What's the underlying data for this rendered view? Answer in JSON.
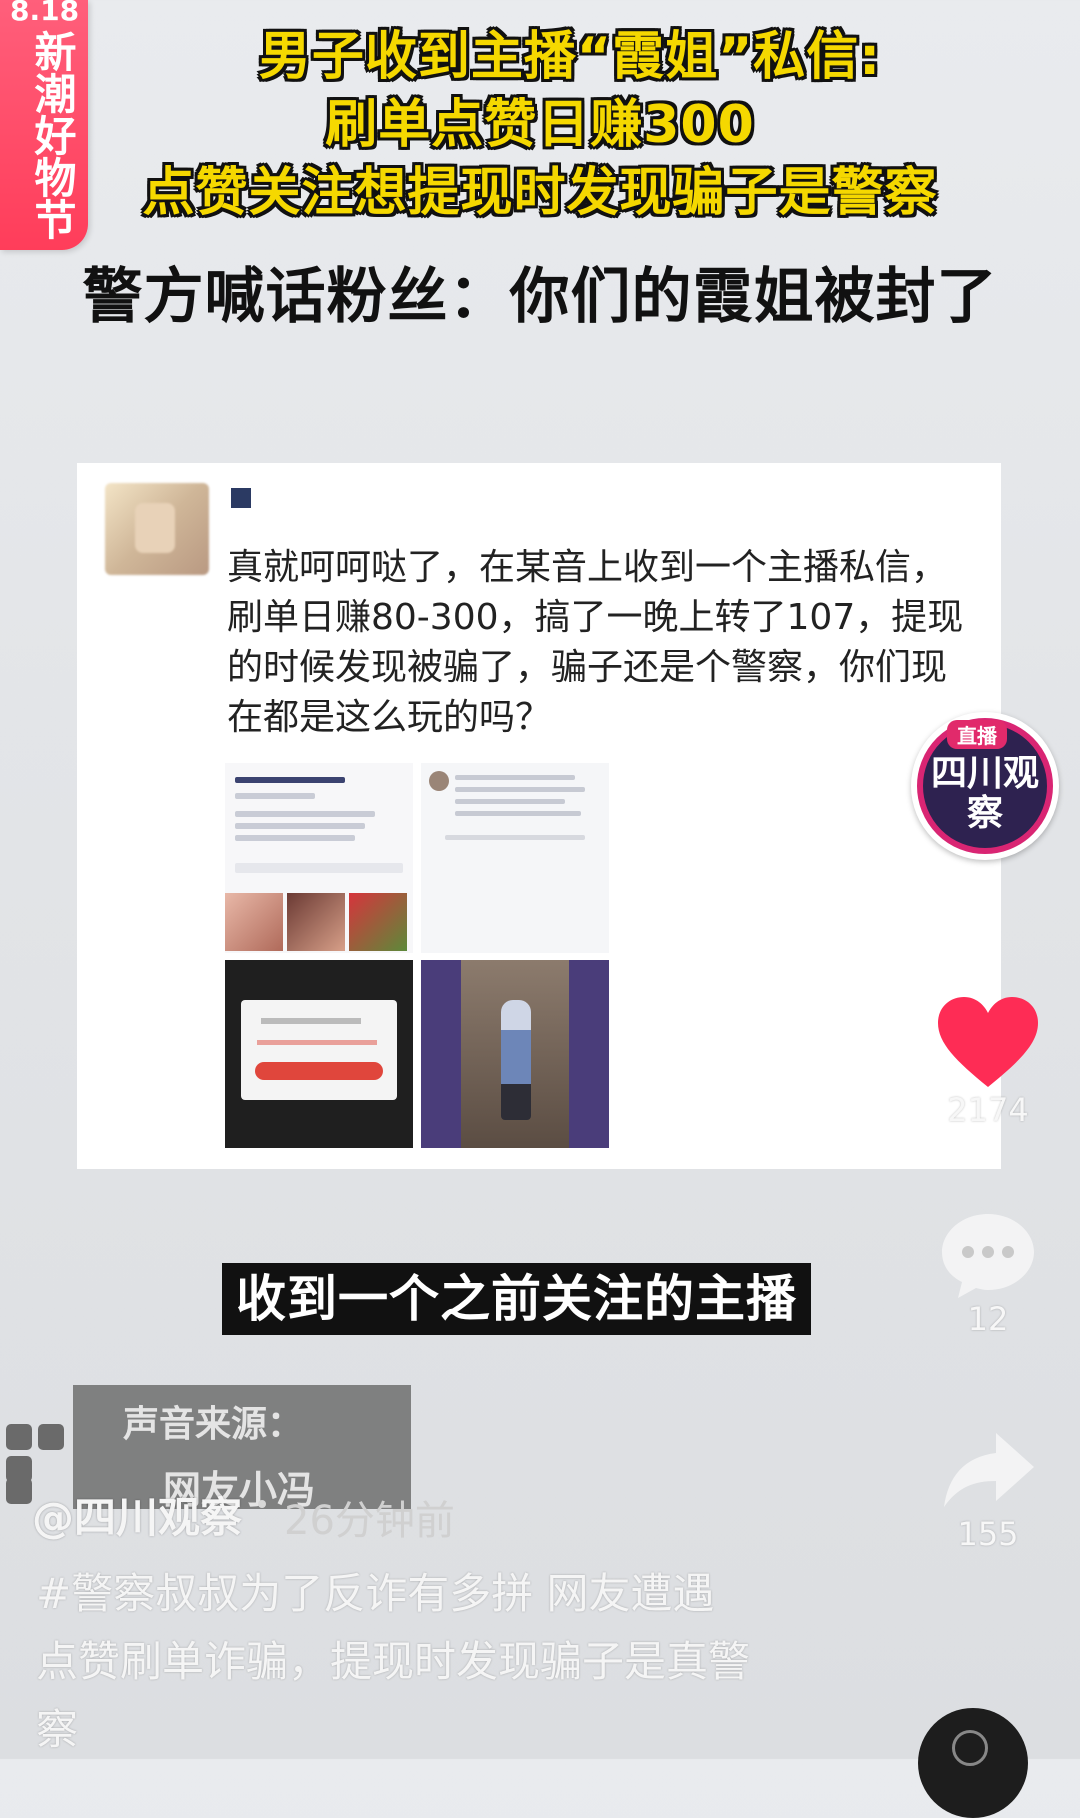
{
  "festival_badge": {
    "top_text": "8.18",
    "label": "新潮好物节"
  },
  "headline": {
    "line1": "男子收到主播“霞姐”私信:",
    "line2": "刷单点赞日赚300",
    "line3": "点赞关注想提现时发现骗子是警察"
  },
  "subheadline": "警方喊话粉丝：你们的霞姐被封了",
  "post": {
    "text": "真就呵呵哒了，在某音上收到一个主播私信，刷单日赚80-300，搞了一晚上转了107，提现的时候发现被骗了，骗子还是个警察，你们现在都是这么玩的吗？"
  },
  "live_badge": {
    "tag": "直播",
    "name": "四川观察"
  },
  "side": {
    "likes": "2174",
    "comments": "12",
    "shares": "155"
  },
  "subtitle": "收到一个之前关注的主播",
  "sound": {
    "title": "声音来源：",
    "name": "网友小冯"
  },
  "author": "@四川观察",
  "time": "26分钟前",
  "description": "#警察叔叔为了反诈有多拼 网友遭遇点赞刷单诈骗，提现时发现骗子是真警察",
  "colors": {
    "accent": "#fe2c55",
    "headline_yellow": "#f5d800"
  }
}
